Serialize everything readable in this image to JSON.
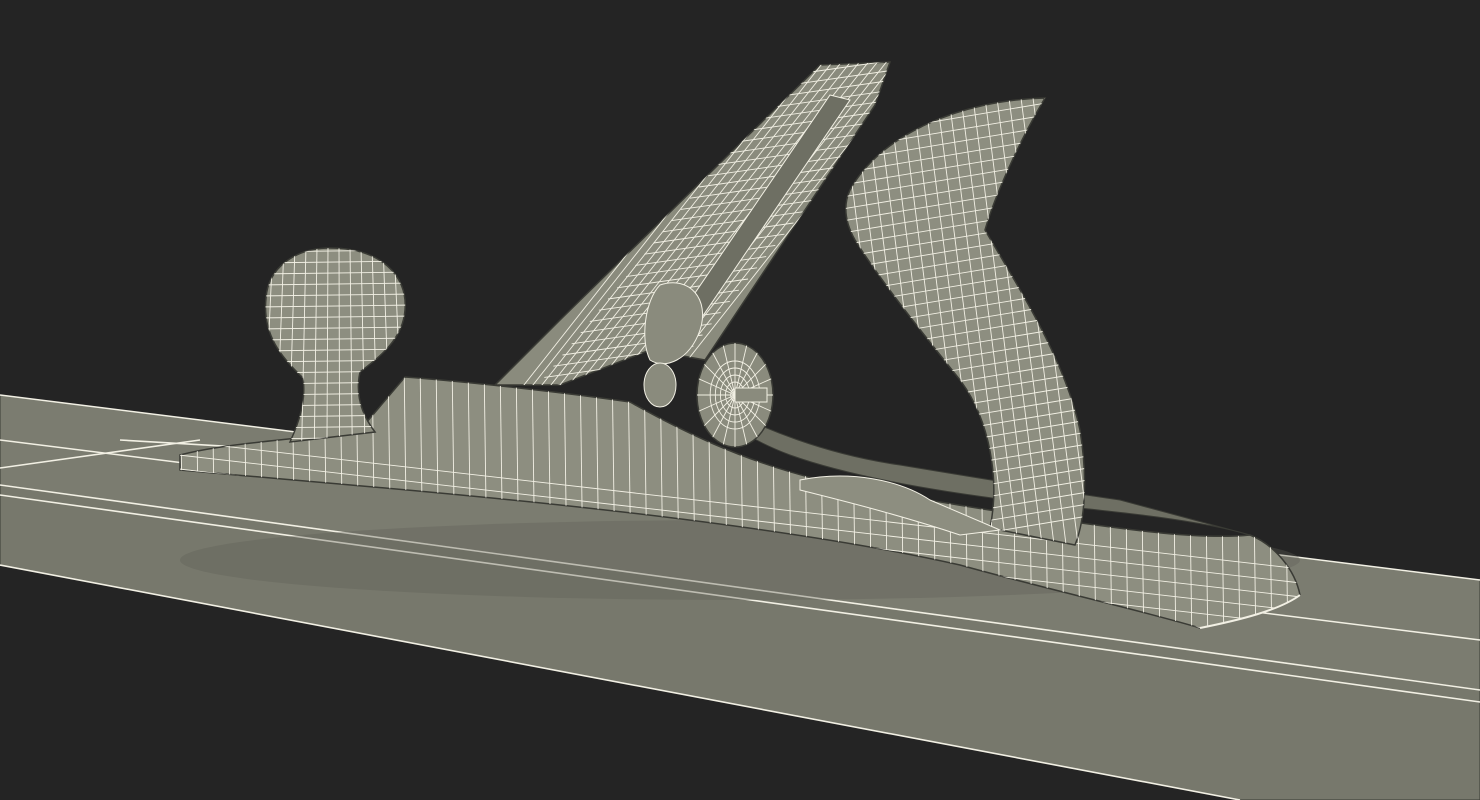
{
  "scene": {
    "subject": "hand-plane-wireframe-model",
    "colors": {
      "background": "#242424",
      "surface_fill": "#7b7c70",
      "model_fill": "#8d8e80",
      "model_fill_dark": "#6e6f63",
      "wire": "#f2f0e4",
      "edge": "#3a3b35"
    }
  }
}
